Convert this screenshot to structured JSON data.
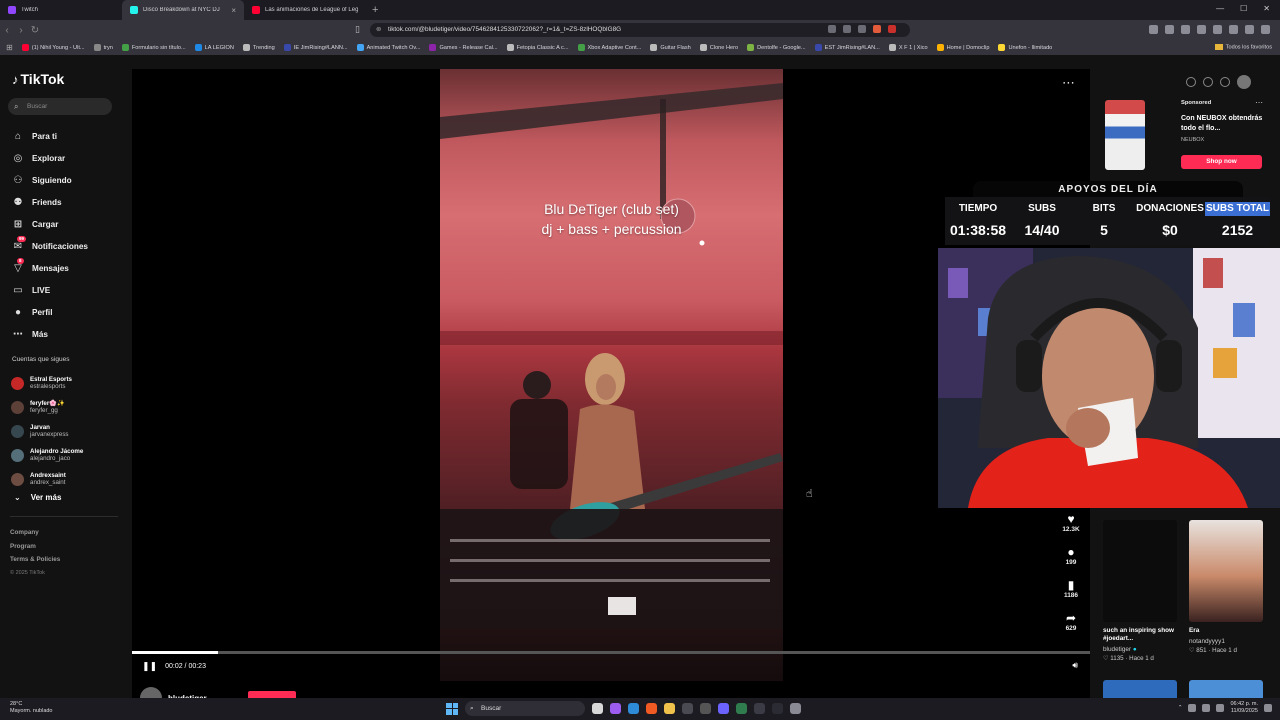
{
  "browser": {
    "tabs": [
      {
        "label": "Twitch",
        "color": "#9146ff",
        "active": false
      },
      {
        "label": "Disco Breakdown at NYC DJ",
        "color": "#25f4ee",
        "active": true
      },
      {
        "label": "Las animaciones de League of Legen",
        "color": "#ff0033",
        "active": false
      }
    ],
    "new_tab": "+",
    "url": "tiktok.com/@bludetiger/video/7546284125330722062?_r=1&_t=ZS-8zlHOQbIG8G",
    "bookmarks": [
      {
        "label": "(1) Nihil Young - Ult...",
        "color": "#ff0033"
      },
      {
        "label": "tryn",
        "color": "#888888"
      },
      {
        "label": "Formulario sin título...",
        "color": "#43a047"
      },
      {
        "label": "LA LEGION",
        "color": "#1e88e5"
      },
      {
        "label": "Trending",
        "color": "#bbbbbb"
      },
      {
        "label": "IE JimRising#LANN...",
        "color": "#3949ab"
      },
      {
        "label": "Animated Twitch Ov...",
        "color": "#42a5f5"
      },
      {
        "label": "Games - Release Cal...",
        "color": "#8e24aa"
      },
      {
        "label": "Fetopia Classic A c...",
        "color": "#bbbbbb"
      },
      {
        "label": "Xbox Adaptive Cont...",
        "color": "#43a047"
      },
      {
        "label": "Guitar Flash",
        "color": "#bbbbbb"
      },
      {
        "label": "Clone Hero",
        "color": "#bbbbbb"
      },
      {
        "label": "Dentolfe - Google...",
        "color": "#7cb342"
      },
      {
        "label": "EST JimRising#LAN...",
        "color": "#3949ab"
      },
      {
        "label": "X F 1 | Xico",
        "color": "#bbbbbb"
      },
      {
        "label": "Home | Domoclip",
        "color": "#ffb300"
      },
      {
        "label": "Unefon - Ilimitado",
        "color": "#fdd835"
      }
    ],
    "all_favorites": "Todos los favoritos"
  },
  "sidebar": {
    "logo": "TikTok",
    "search_placeholder": "Buscar",
    "items": [
      {
        "label": "Para ti",
        "icon": "home-icon",
        "glyph": "⌂"
      },
      {
        "label": "Explorar",
        "icon": "compass-icon",
        "glyph": "◎"
      },
      {
        "label": "Siguiendo",
        "icon": "following-icon",
        "glyph": "⚇"
      },
      {
        "label": "Friends",
        "icon": "friends-icon",
        "glyph": "⚉"
      },
      {
        "label": "Cargar",
        "icon": "upload-icon",
        "glyph": "⊞"
      },
      {
        "label": "Notificaciones",
        "icon": "notifications-icon",
        "glyph": "✉",
        "badge": "99"
      },
      {
        "label": "Mensajes",
        "icon": "messages-icon",
        "glyph": "▽",
        "badge": "8"
      },
      {
        "label": "LIVE",
        "icon": "live-icon",
        "glyph": "▭"
      },
      {
        "label": "Perfil",
        "icon": "profile-icon",
        "glyph": "●"
      },
      {
        "label": "Más",
        "icon": "more-icon",
        "glyph": "⋯"
      }
    ],
    "following_title": "Cuentas que sigues",
    "following": [
      {
        "name": "Estral Esports",
        "handle": "estralesports",
        "color": "#c62828"
      },
      {
        "name": "feryfer🌸✨",
        "handle": "feryfer_gg",
        "color": "#5d4037"
      },
      {
        "name": "Jarvan",
        "handle": "jarvanexpress",
        "color": "#37474f"
      },
      {
        "name": "Alejandro Jácome",
        "handle": "alejandro_jaco",
        "color": "#546e7a"
      },
      {
        "name": "Andrexsaint",
        "handle": "andrex_saint",
        "color": "#6d4c41"
      }
    ],
    "see_more": "Ver más",
    "footer": [
      "Company",
      "Program",
      "Terms & Policies"
    ],
    "copyright": "© 2025 TikTok"
  },
  "player": {
    "caption_line1": "Blu DeTiger (club set)",
    "caption_line2": "dj + bass + percussion",
    "time": "00:02 / 00:23",
    "progress": 0.09,
    "author": "bludetiger",
    "actions": [
      {
        "icon": "heart-icon",
        "glyph": "♥",
        "count": "12.3K"
      },
      {
        "icon": "comment-icon",
        "glyph": "●",
        "count": "199"
      },
      {
        "icon": "bookmark-icon",
        "glyph": "▮",
        "count": "1186"
      },
      {
        "icon": "share-icon",
        "glyph": "➦",
        "count": "629"
      }
    ]
  },
  "ad": {
    "sponsored": "Sponsored",
    "text": "Con NEUBOX obtendrás todo el flo...",
    "brand": "NEUBOX",
    "cta": "Shop now"
  },
  "overlay": {
    "title": "APOYOS DEL DÍA",
    "columns": [
      {
        "label": "TIEMPO",
        "value": "01:38:58"
      },
      {
        "label": "SUBS",
        "value": "14/40"
      },
      {
        "label": "BITS",
        "value": "5"
      },
      {
        "label": "DONACIONES",
        "value": "$0"
      },
      {
        "label": "SUBS TOTAL",
        "value": "2152"
      }
    ]
  },
  "recommended": [
    {
      "title": "such an inspiring show #joedart...",
      "author": "bludetiger",
      "likes": "1135",
      "age": "Hace 1 d",
      "color": "#0c0c0c"
    },
    {
      "title": "Era",
      "author": "notandyyyy1",
      "likes": "851",
      "age": "Hace 1 d",
      "color": "#c98a6a"
    }
  ],
  "taskbar": {
    "weather_temp": "28°C",
    "weather_desc": "Mayorm. nublado",
    "search": "Buscar",
    "time": "06:42 p. m.",
    "date": "11/09/2025"
  }
}
